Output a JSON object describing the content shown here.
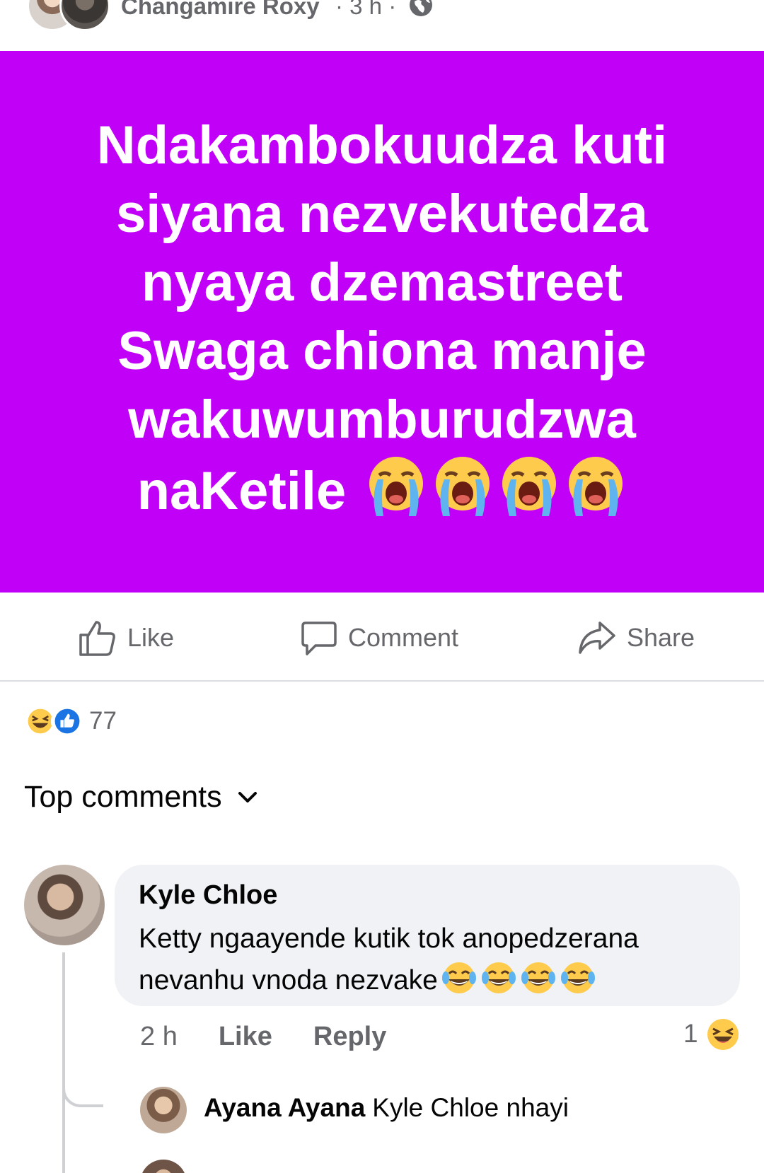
{
  "post": {
    "author": "Changamire Roxy",
    "meta": "· 3 h ·",
    "privacy_icon": "globe-icon",
    "background_color": "#c100f8",
    "text_lines": [
      "Ndakambokuudza kuti",
      "siyana nezvekutedza",
      "nyaya dzemastreet",
      "Swaga chiona manje",
      "wakuwumburudzwa",
      "naKetile"
    ],
    "trailing_emoji": "loudly-crying-face x4"
  },
  "actions": {
    "like": "Like",
    "comment": "Comment",
    "share": "Share"
  },
  "reactions": {
    "types": [
      "haha",
      "like"
    ],
    "count": "77"
  },
  "comments_filter": {
    "label": "Top comments"
  },
  "comment": {
    "author": "Kyle Chloe",
    "text": "Ketty ngaayende kutik tok anopedzerana nevanhu vnoda nezvake",
    "trailing_emoji": "face-with-tears-of-joy x4",
    "time": "2 h",
    "like_label": "Like",
    "reply_label": "Reply",
    "reaction_count": "1",
    "reaction_type": "haha"
  },
  "reply": {
    "author": "Ayana Ayana",
    "text": "Kyle Chloe nhayi"
  }
}
